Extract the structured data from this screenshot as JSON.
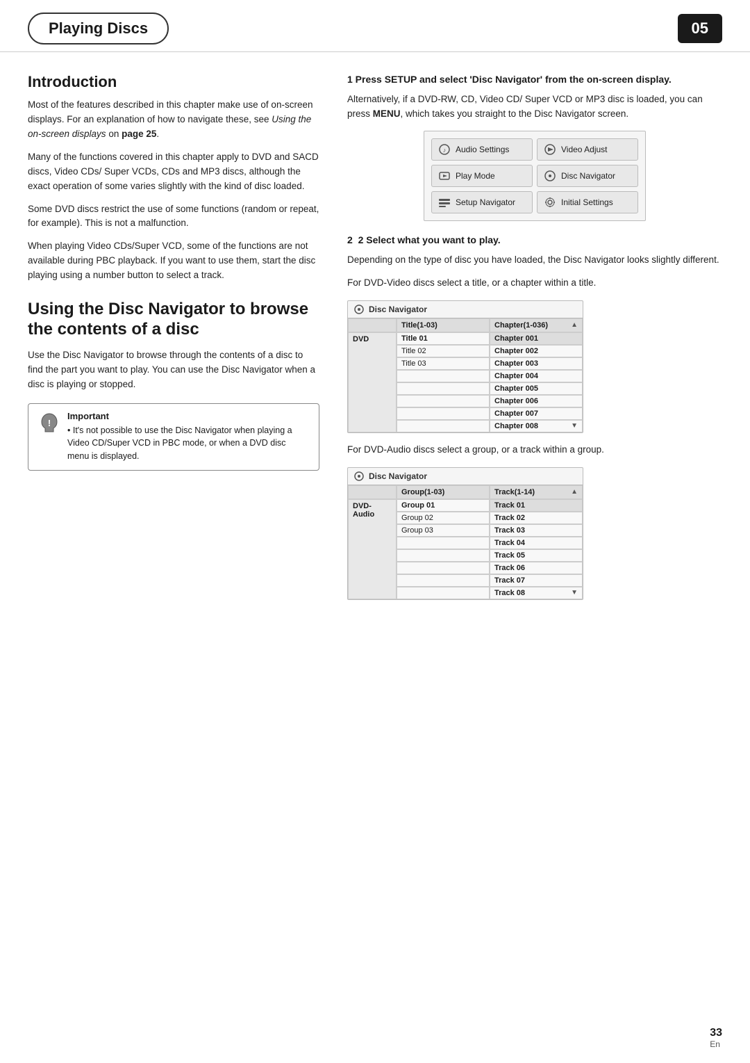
{
  "header": {
    "chapter_title": "Playing Discs",
    "page_number": "05"
  },
  "introduction": {
    "title": "Introduction",
    "paragraphs": [
      "Most of the features described in this chapter make use of on-screen displays. For an explanation of how to navigate these, see Using the on-screen displays on page 25.",
      "Many of the functions covered in this chapter apply to DVD and SACD discs, Video CDs/ Super VCDs, CDs and MP3 discs, although the exact operation of some varies slightly with the kind of disc loaded.",
      "Some DVD discs restrict the use of some functions (random or repeat, for example). This is not a malfunction.",
      "When playing Video CDs/Super VCD, some of the functions are not available during PBC playback. If you want to use them, start the disc playing using a number button to select a track."
    ]
  },
  "disc_navigator_section": {
    "title": "Using the Disc Navigator to browse the contents of a disc",
    "description": "Use the Disc Navigator to browse through the contents of a disc to find the part you want to play. You can use the Disc Navigator when a disc is playing or stopped.",
    "important": {
      "title": "Important",
      "text": "• It's not possible to use the Disc Navigator when playing a Video CD/Super VCD in PBC mode, or when a DVD disc menu is displayed."
    }
  },
  "step1": {
    "heading": "1   Press SETUP and select 'Disc Navigator' from the on-screen display.",
    "body": "Alternatively, if a DVD-RW, CD, Video CD/ Super VCD or MP3 disc is loaded, you can press MENU, which takes you straight to the Disc Navigator screen.",
    "menu": {
      "items": [
        {
          "icon": "♪",
          "label": "Audio Settings"
        },
        {
          "icon": "◑",
          "label": "Video Adjust"
        },
        {
          "icon": "▷",
          "label": "Play Mode"
        },
        {
          "icon": "⊙",
          "label": "Disc Navigator"
        },
        {
          "icon": "⚙",
          "label": "Setup Navigator"
        },
        {
          "icon": "◎",
          "label": "Initial Settings"
        }
      ]
    }
  },
  "step2": {
    "heading": "2   Select what you want to play.",
    "body1": "Depending on the type of disc you have loaded, the Disc Navigator looks slightly different.",
    "body2": "For DVD-Video discs select a title, or a chapter within a title.",
    "dvd_table": {
      "header": "Disc Navigator",
      "row_label": "DVD",
      "col1_header": "Title(1-03)",
      "col2_header": "Chapter(1-036)",
      "titles": [
        "Title 01",
        "Title 02",
        "Title 03"
      ],
      "chapters": [
        "Chapter 001",
        "Chapter 002",
        "Chapter 003",
        "Chapter 004",
        "Chapter 005",
        "Chapter 006",
        "Chapter 007",
        "Chapter 008"
      ]
    },
    "body3": "For DVD-Audio discs select a group, or a track within a group.",
    "dvdaudio_table": {
      "header": "Disc Navigator",
      "row_label": "DVD-Audio",
      "col1_header": "Group(1-03)",
      "col2_header": "Track(1-14)",
      "groups": [
        "Group 01",
        "Group 02",
        "Group 03"
      ],
      "tracks": [
        "Track 01",
        "Track 02",
        "Track 03",
        "Track 04",
        "Track 05",
        "Track 06",
        "Track 07",
        "Track 08"
      ]
    }
  },
  "footer": {
    "page_num": "33",
    "lang": "En"
  }
}
